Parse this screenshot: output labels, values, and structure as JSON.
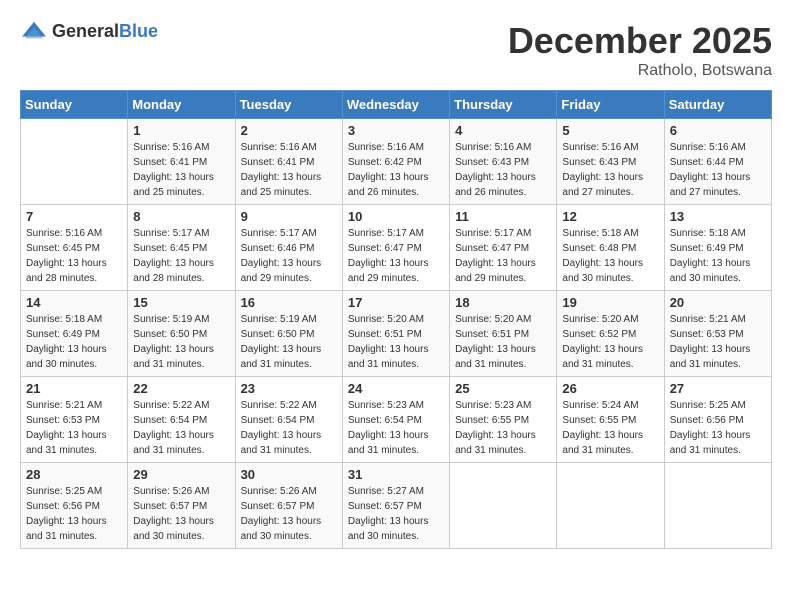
{
  "logo": {
    "general": "General",
    "blue": "Blue"
  },
  "header": {
    "month": "December 2025",
    "location": "Ratholo, Botswana"
  },
  "days_of_week": [
    "Sunday",
    "Monday",
    "Tuesday",
    "Wednesday",
    "Thursday",
    "Friday",
    "Saturday"
  ],
  "weeks": [
    [
      {
        "day": "",
        "info": ""
      },
      {
        "day": "1",
        "info": "Sunrise: 5:16 AM\nSunset: 6:41 PM\nDaylight: 13 hours\nand 25 minutes."
      },
      {
        "day": "2",
        "info": "Sunrise: 5:16 AM\nSunset: 6:41 PM\nDaylight: 13 hours\nand 25 minutes."
      },
      {
        "day": "3",
        "info": "Sunrise: 5:16 AM\nSunset: 6:42 PM\nDaylight: 13 hours\nand 26 minutes."
      },
      {
        "day": "4",
        "info": "Sunrise: 5:16 AM\nSunset: 6:43 PM\nDaylight: 13 hours\nand 26 minutes."
      },
      {
        "day": "5",
        "info": "Sunrise: 5:16 AM\nSunset: 6:43 PM\nDaylight: 13 hours\nand 27 minutes."
      },
      {
        "day": "6",
        "info": "Sunrise: 5:16 AM\nSunset: 6:44 PM\nDaylight: 13 hours\nand 27 minutes."
      }
    ],
    [
      {
        "day": "7",
        "info": "Sunrise: 5:16 AM\nSunset: 6:45 PM\nDaylight: 13 hours\nand 28 minutes."
      },
      {
        "day": "8",
        "info": "Sunrise: 5:17 AM\nSunset: 6:45 PM\nDaylight: 13 hours\nand 28 minutes."
      },
      {
        "day": "9",
        "info": "Sunrise: 5:17 AM\nSunset: 6:46 PM\nDaylight: 13 hours\nand 29 minutes."
      },
      {
        "day": "10",
        "info": "Sunrise: 5:17 AM\nSunset: 6:47 PM\nDaylight: 13 hours\nand 29 minutes."
      },
      {
        "day": "11",
        "info": "Sunrise: 5:17 AM\nSunset: 6:47 PM\nDaylight: 13 hours\nand 29 minutes."
      },
      {
        "day": "12",
        "info": "Sunrise: 5:18 AM\nSunset: 6:48 PM\nDaylight: 13 hours\nand 30 minutes."
      },
      {
        "day": "13",
        "info": "Sunrise: 5:18 AM\nSunset: 6:49 PM\nDaylight: 13 hours\nand 30 minutes."
      }
    ],
    [
      {
        "day": "14",
        "info": "Sunrise: 5:18 AM\nSunset: 6:49 PM\nDaylight: 13 hours\nand 30 minutes."
      },
      {
        "day": "15",
        "info": "Sunrise: 5:19 AM\nSunset: 6:50 PM\nDaylight: 13 hours\nand 31 minutes."
      },
      {
        "day": "16",
        "info": "Sunrise: 5:19 AM\nSunset: 6:50 PM\nDaylight: 13 hours\nand 31 minutes."
      },
      {
        "day": "17",
        "info": "Sunrise: 5:20 AM\nSunset: 6:51 PM\nDaylight: 13 hours\nand 31 minutes."
      },
      {
        "day": "18",
        "info": "Sunrise: 5:20 AM\nSunset: 6:51 PM\nDaylight: 13 hours\nand 31 minutes."
      },
      {
        "day": "19",
        "info": "Sunrise: 5:20 AM\nSunset: 6:52 PM\nDaylight: 13 hours\nand 31 minutes."
      },
      {
        "day": "20",
        "info": "Sunrise: 5:21 AM\nSunset: 6:53 PM\nDaylight: 13 hours\nand 31 minutes."
      }
    ],
    [
      {
        "day": "21",
        "info": "Sunrise: 5:21 AM\nSunset: 6:53 PM\nDaylight: 13 hours\nand 31 minutes."
      },
      {
        "day": "22",
        "info": "Sunrise: 5:22 AM\nSunset: 6:54 PM\nDaylight: 13 hours\nand 31 minutes."
      },
      {
        "day": "23",
        "info": "Sunrise: 5:22 AM\nSunset: 6:54 PM\nDaylight: 13 hours\nand 31 minutes."
      },
      {
        "day": "24",
        "info": "Sunrise: 5:23 AM\nSunset: 6:54 PM\nDaylight: 13 hours\nand 31 minutes."
      },
      {
        "day": "25",
        "info": "Sunrise: 5:23 AM\nSunset: 6:55 PM\nDaylight: 13 hours\nand 31 minutes."
      },
      {
        "day": "26",
        "info": "Sunrise: 5:24 AM\nSunset: 6:55 PM\nDaylight: 13 hours\nand 31 minutes."
      },
      {
        "day": "27",
        "info": "Sunrise: 5:25 AM\nSunset: 6:56 PM\nDaylight: 13 hours\nand 31 minutes."
      }
    ],
    [
      {
        "day": "28",
        "info": "Sunrise: 5:25 AM\nSunset: 6:56 PM\nDaylight: 13 hours\nand 31 minutes."
      },
      {
        "day": "29",
        "info": "Sunrise: 5:26 AM\nSunset: 6:57 PM\nDaylight: 13 hours\nand 30 minutes."
      },
      {
        "day": "30",
        "info": "Sunrise: 5:26 AM\nSunset: 6:57 PM\nDaylight: 13 hours\nand 30 minutes."
      },
      {
        "day": "31",
        "info": "Sunrise: 5:27 AM\nSunset: 6:57 PM\nDaylight: 13 hours\nand 30 minutes."
      },
      {
        "day": "",
        "info": ""
      },
      {
        "day": "",
        "info": ""
      },
      {
        "day": "",
        "info": ""
      }
    ]
  ]
}
